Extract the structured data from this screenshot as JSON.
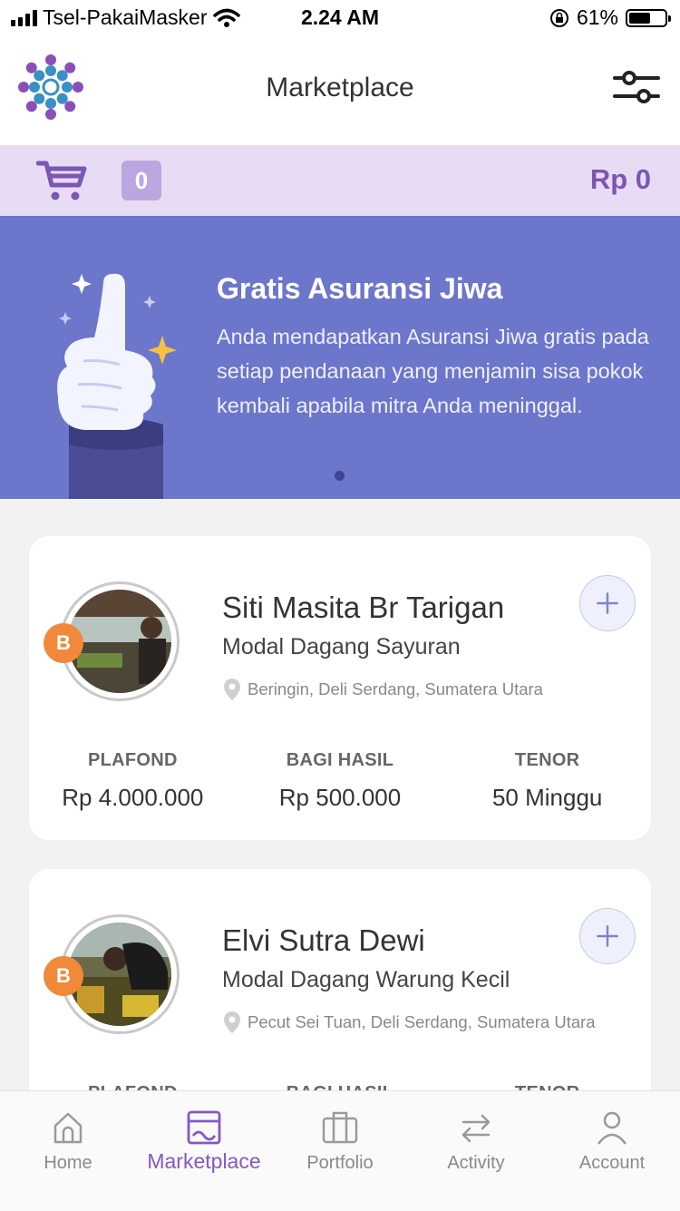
{
  "status_bar": {
    "carrier": "Tsel-PakaiMasker",
    "time": "2.24 AM",
    "battery": "61%",
    "battery_level": 0.61
  },
  "header": {
    "title": "Marketplace",
    "logo_icon": "flower-logo-icon",
    "filter_icon": "filter-sliders-icon"
  },
  "cart": {
    "icon": "cart-icon",
    "count": "0",
    "total": "Rp 0",
    "accent_color": "#7b56b3"
  },
  "banner": {
    "title": "Gratis Asuransi Jiwa",
    "text": "Anda mendapatkan Asuransi Jiwa gratis pada setiap pendanaan yang menjamin sisa pokok kembali apabila mitra Anda meninggal.",
    "background_color": "#6c76cb",
    "illustration": "thumbs-up-illustration"
  },
  "loans": [
    {
      "name": "Siti Masita Br Tarigan",
      "purpose": "Modal Dagang Sayuran",
      "location": "Beringin, Deli Serdang, Sumatera Utara",
      "grade": "B",
      "stats": {
        "plafond_label": "PLAFOND",
        "plafond": "Rp 4.000.000",
        "bagi_hasil_label": "BAGI HASIL",
        "bagi_hasil": "Rp 500.000",
        "tenor_label": "TENOR",
        "tenor": "50 Minggu"
      }
    },
    {
      "name": "Elvi Sutra Dewi",
      "purpose": "Modal Dagang Warung Kecil",
      "location": "Pecut Sei Tuan, Deli Serdang, Sumatera Utara",
      "grade": "B",
      "stats": {
        "plafond_label": "PLAFOND",
        "plafond": "",
        "bagi_hasil_label": "BAGI HASIL",
        "bagi_hasil": "",
        "tenor_label": "TENOR",
        "tenor": ""
      }
    }
  ],
  "nav": {
    "items": [
      {
        "label": "Home",
        "icon": "home-icon"
      },
      {
        "label": "Marketplace",
        "icon": "marketplace-icon"
      },
      {
        "label": "Portfolio",
        "icon": "briefcase-icon"
      },
      {
        "label": "Activity",
        "icon": "arrows-exchange-icon"
      },
      {
        "label": "Account",
        "icon": "user-icon"
      }
    ],
    "active_color": "#8458c5"
  }
}
